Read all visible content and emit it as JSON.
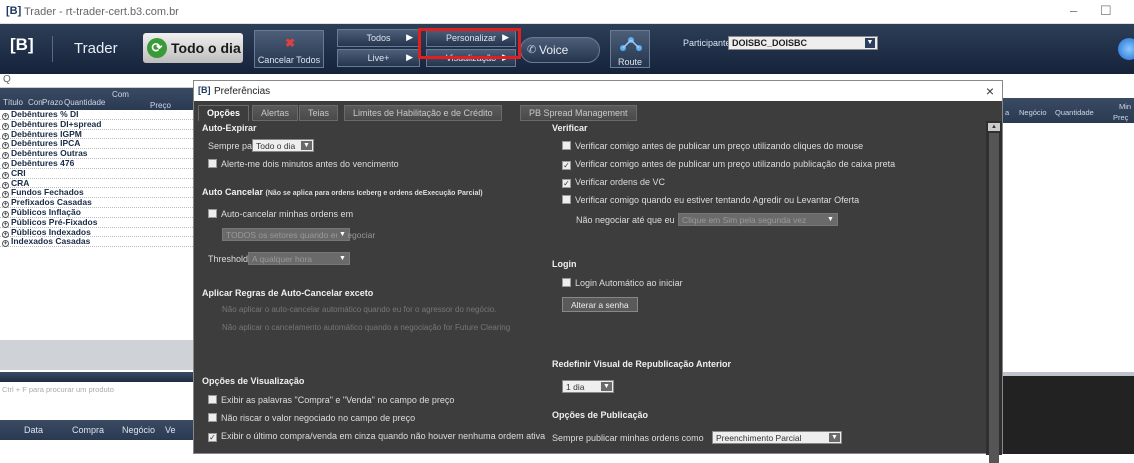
{
  "window": {
    "title": "Trader - rt-trader-cert.b3.com.br",
    "logo": "[B]"
  },
  "toolbar": {
    "logo": "[B]",
    "trader": "Trader",
    "todo_o_dia": "Todo o dia",
    "cancelar_todos": "Cancelar Todos",
    "todos": "Todos",
    "live": "Live+",
    "personalizar": "Personalizar",
    "visualizacao": "Visualização",
    "voice": "Voice",
    "route": "Route",
    "participante_label": "Participante:",
    "participante_value": "DOISBC_DOISBC"
  },
  "left": {
    "search": "Q",
    "columns": [
      "Título",
      "Con",
      "Prazo",
      "Quantidade",
      "Com",
      "Preço"
    ],
    "items": [
      "Debêntures % DI",
      "Debêntures DI+spread",
      "Debêntures IGPM",
      "Debêntures IPCA",
      "Debêntures Outras",
      "Debêntures 476",
      "CRI",
      "CRA",
      "Fundos Fechados",
      "Prefixados Casadas",
      "Públicos Inflação",
      "Públicos Pré-Fixados",
      "Públicos Indexados",
      "Indexados Casadas"
    ],
    "hint": "Ctrl + F para procurar um produto",
    "trade_cols": [
      "Data",
      "Compra",
      "Negócio",
      "Ve"
    ]
  },
  "right": {
    "columns": [
      "a",
      "Negócio",
      "Quantidade",
      "Min",
      "Preç"
    ]
  },
  "dialog": {
    "logo": "[B]",
    "title": "Preferências",
    "close": "×",
    "tabs": [
      "Opções",
      "Alertas",
      "Teias",
      "Limites de Habilitação e de Crédito",
      "PB Spread Management"
    ],
    "auto_expirar": {
      "heading": "Auto-Expirar",
      "sempre_para": "Sempre para",
      "sempre_para_value": "Todo o dia",
      "alerte": "Alerte-me dois minutos antes do vencimento"
    },
    "auto_cancelar": {
      "heading": "Auto Cancelar",
      "note": "(Não se aplica para ordens Iceberg e ordens deExecução Parcial)",
      "checkbox": "Auto-cancelar minhas ordens em",
      "select": "TODOS os setores quando eu negociar",
      "threshold": "Threshold",
      "threshold_value": "A qualquer hora"
    },
    "regras": {
      "heading": "Aplicar Regras de Auto-Cancelar exceto",
      "line1": "Não aplicar o auto-cancelar automático quando eu for o agressor do negócio.",
      "line2": "Não aplicar o cancelamento automático quando a negociação for Future Clearing"
    },
    "visualizacao": {
      "heading": "Opções de Visualização",
      "opt1": "Exibir as palavras \"Compra\" e \"Venda\" no campo de preço",
      "opt2": "Não riscar o valor negociado no campo de preço",
      "opt3": "Exibir o último compra/venda em cinza quando não houver nenhuma ordem ativa"
    },
    "verificar": {
      "heading": "Verificar",
      "opt1": "Verificar comigo antes de publicar um preço utilizando cliques do mouse",
      "opt2": "Verificar comigo antes de publicar um preço utilizando publicação de caixa preta",
      "opt3": "Verificar ordens de VC",
      "opt4": "Verificar comigo quando eu estiver tentando Agredir ou Levantar Oferta",
      "nao_negociar": "Não negociar até que eu",
      "nao_negociar_value": "Clique em Sim pela segunda vez"
    },
    "login": {
      "heading": "Login",
      "auto": "Login Automático ao iniciar",
      "alterar": "Alterar a senha"
    },
    "redefinir": {
      "heading": "Redefinir Visual de Republicação Anterior",
      "value": "1 dia"
    },
    "publicacao": {
      "heading": "Opções de Publicação",
      "label": "Sempre publicar minhas ordens como",
      "value": "Preenchimento Parcial"
    }
  }
}
